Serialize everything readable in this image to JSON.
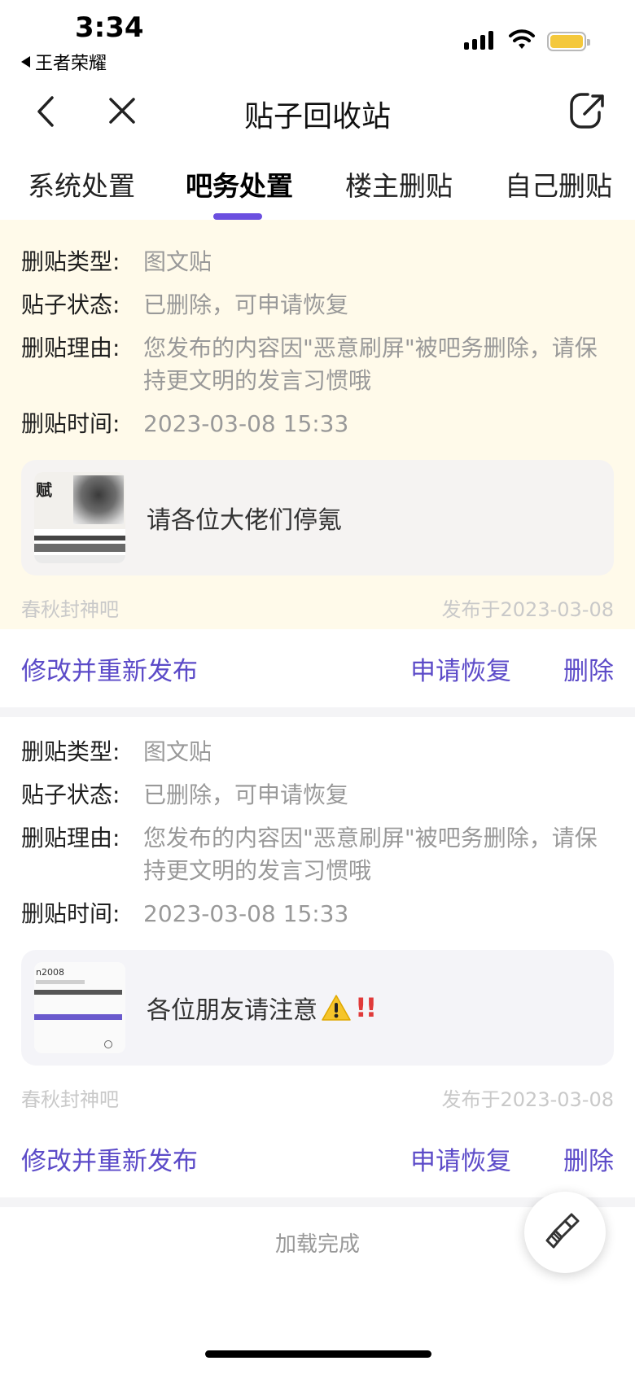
{
  "status_bar": {
    "time": "3:34",
    "back_app": "王者荣耀",
    "battery_color": "#f4c83c"
  },
  "nav": {
    "title": "贴子回收站",
    "back_icon": "chevron-left-icon",
    "close_icon": "close-icon",
    "share_icon": "share-icon"
  },
  "tabs": [
    {
      "label": "系统处置",
      "active": false
    },
    {
      "label": "吧务处置",
      "active": true
    },
    {
      "label": "楼主删贴",
      "active": false
    },
    {
      "label": "自己删贴",
      "active": false
    }
  ],
  "accent_color": "#6b4fe0",
  "cards": [
    {
      "type_label": "删贴类型:",
      "type_value": "图文贴",
      "status_label": "贴子状态:",
      "status_value": "已删除，可申请恢复",
      "reason_label": "删贴理由:",
      "reason_value": "您发布的内容因\"恶意刷屏\"被吧务删除，请保持更文明的发言习惯哦",
      "time_label": "删贴时间:",
      "time_value": "2023-03-08 15:33",
      "post_title": "请各位大佬们停氪",
      "forum": "春秋封神吧",
      "published": "发布于2023-03-08",
      "action_edit": "修改并重新发布",
      "action_restore": "申请恢复",
      "action_delete": "删除",
      "thumb_caption": "赋"
    },
    {
      "type_label": "删贴类型:",
      "type_value": "图文贴",
      "status_label": "贴子状态:",
      "status_value": "已删除，可申请恢复",
      "reason_label": "删贴理由:",
      "reason_value": "您发布的内容因\"恶意刷屏\"被吧务删除，请保持更文明的发言习惯哦",
      "time_label": "删贴时间:",
      "time_value": "2023-03-08 15:33",
      "post_title": "各位朋友请注意",
      "post_title_emoji": "⚠️‼️",
      "forum": "春秋封神吧",
      "published": "发布于2023-03-08",
      "action_edit": "修改并重新发布",
      "action_restore": "申请恢复",
      "action_delete": "删除",
      "thumb_caption": "n2008"
    }
  ],
  "footer": {
    "load_status": "加载完成",
    "fab_icon": "broom-icon"
  }
}
